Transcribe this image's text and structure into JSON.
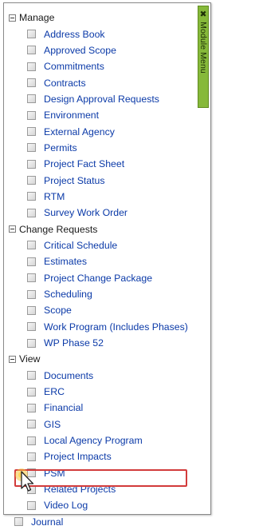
{
  "module_tab": {
    "label": "Module Menu",
    "icon": "close-x-icon",
    "color": "#86b93a"
  },
  "highlight_color": "#d23b3b",
  "groups": [
    {
      "label": "Manage",
      "items": [
        "Address Book",
        "Approved Scope",
        "Commitments",
        "Contracts",
        "Design Approval Requests",
        "Environment",
        "External Agency",
        "Permits",
        "Project Fact Sheet",
        "Project Status",
        "RTM",
        "Survey Work Order"
      ]
    },
    {
      "label": "Change Requests",
      "items": [
        "Critical Schedule",
        "Estimates",
        "Project Change Package",
        "Scheduling",
        "Scope",
        "Work Program (Includes Phases)",
        "WP Phase 52"
      ]
    },
    {
      "label": "View",
      "items": [
        "Documents",
        "ERC",
        "Financial",
        "GIS",
        "Local Agency Program",
        "Project Impacts",
        "PSM",
        "Related Projects",
        "Video Log"
      ]
    }
  ],
  "top_level_items": [
    "Journal"
  ]
}
